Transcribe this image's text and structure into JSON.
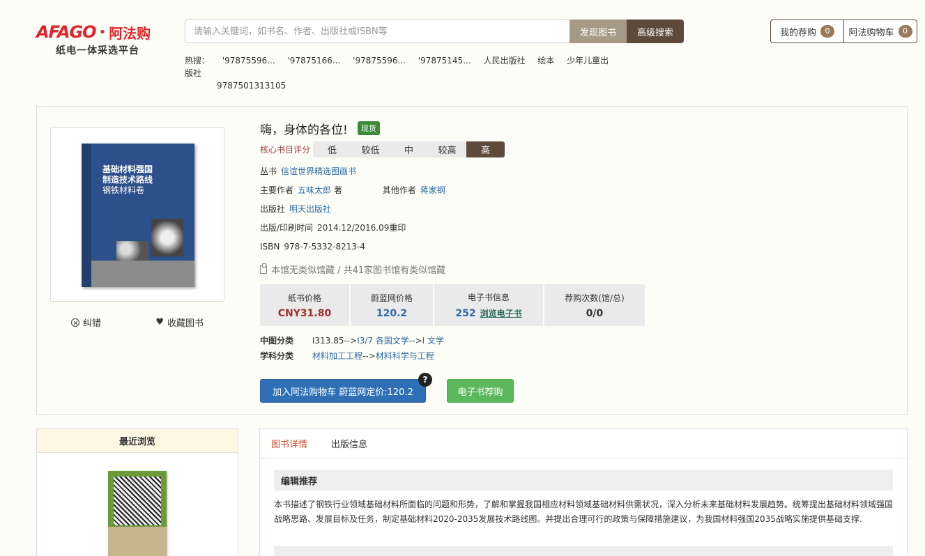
{
  "header": {
    "logo_mark": "AFAGO",
    "logo_cn": "阿法购",
    "logo_sub": "纸电一体采选平台",
    "search_placeholder": "请输入关键词，如书名、作者、出版社或ISBN等",
    "discover_label": "发现图书",
    "advanced_label": "高级搜索",
    "hot_label": "热搜：",
    "hot_keywords": [
      "'97875596...",
      "'97875166...",
      "'97875596...",
      "'97875145...",
      "人民出版社",
      "绘本",
      "少年儿童出版社"
    ],
    "hot_wrap": "9787501313105",
    "my_recommend_label": "我的荐购",
    "my_recommend_count": "0",
    "cart_label": "阿法购物车",
    "cart_count": "0"
  },
  "book": {
    "title": "嗨，身体的各位!",
    "stock_badge": "现货",
    "cover_title1": "基础材料强国\n制造技术路线",
    "cover_title2": "钢铁材料卷",
    "rating_label": "核心书目评分",
    "rating_levels": [
      "低",
      "较低",
      "中",
      "较高",
      "高"
    ],
    "rating_active": 4,
    "series_label": "丛书",
    "series_value": "信谊世界精选图画书",
    "author_label": "主要作者",
    "author_value": "五味太郎",
    "author_role": "著",
    "other_author_label": "其他作者",
    "other_author_value": "蒋家钢",
    "publisher_label": "出版社",
    "publisher_value": "明天出版社",
    "pubdate_label": "出版/印刷时间",
    "pubdate_value": "2014.12/2016.09重印",
    "isbn_label": "ISBN",
    "isbn_value": "978-7-5332-8213-4",
    "holding_text": "本馆无类似馆藏 / 共41家图书馆有类似馆藏",
    "correct_label": "纠错",
    "favorite_label": "收藏图书"
  },
  "prices": {
    "paper_label": "纸书价格",
    "paper_value": "CNY31.80",
    "weilan_label": "蔚蓝网价格",
    "weilan_value": "120.2",
    "ebook_label": "电子书信息",
    "ebook_value": "252",
    "ebook_link": "浏览电子书",
    "recommend_label": "荐购次数(馆/总)",
    "recommend_value": "0/0"
  },
  "classification": {
    "clc_label": "中图分类",
    "clc_code": "I313.85-->",
    "clc_link1": "I3/7 各国文学",
    "clc_sep": " -->",
    "clc_link2": "I 文学",
    "subject_label": "学科分类",
    "subject_link1": "材料加工工程",
    "subject_sep": " -->",
    "subject_link2": "材料科学与工程"
  },
  "actions": {
    "add_cart_label": "加入阿法购物车 蔚蓝网定价:120.2",
    "help_badge": "?",
    "ebook_recommend_label": "电子书荐购"
  },
  "recent": {
    "title": "最近浏览"
  },
  "details": {
    "tab_detail": "图书详情",
    "tab_pubinfo": "出版信息",
    "editor_heading": "编辑推荐",
    "editor_text": "本书描述了钢铁行业领域基础材料所面临的问题和形势，了解和掌握我国相应材料领域基础材料供需状况，深入分析未来基础材料发展趋势。统筹提出基础材料领域强国战略思路、发展目标及任务，制定基础材料2020-2035发展技术路线图。并提出合理可行的政策与保障措施建议，为我国材料强国2035战略实施提供基础支撑."
  },
  "colors": {
    "brand_red": "#e0262a",
    "brown": "#5d4a3a",
    "blue_btn": "#2f6fb6",
    "green_btn": "#5cb85c"
  }
}
